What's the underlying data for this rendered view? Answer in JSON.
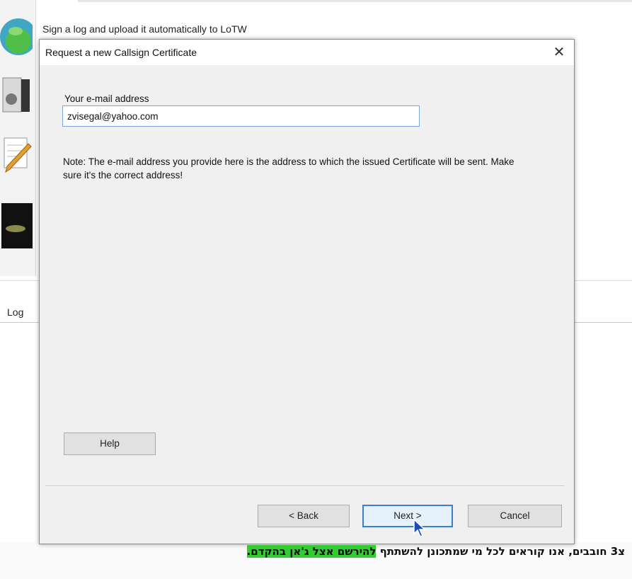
{
  "background_app": {
    "caption": "Sign a log and upload it automatically to LoTW",
    "log_label": "Log"
  },
  "dialog": {
    "title": "Request a new Callsign Certificate",
    "close_symbol": "✕",
    "email_label": "Your e-mail address",
    "email_value": "zvisegal@yahoo.com",
    "note": "Note: The e-mail address you provide here is the address to which the issued Certificate will be sent. Make sure it's the correct address!",
    "buttons": {
      "help": "Help",
      "back": "< Back",
      "next": "Next >",
      "cancel": "Cancel"
    }
  },
  "subtitle": {
    "plain": "צ3 חובבים, אנו קוראים לכל מי שמתכונן להשתתף ",
    "highlighted": "להירשם אצל ג'אן בהקדם."
  },
  "icons": [
    "globe-icon",
    "document-icon",
    "edit-pencil-icon",
    "dark-logo-icon",
    "mouse-cursor-icon"
  ],
  "colors": {
    "dialog_bg": "#f0f0f0",
    "focus_border": "#3c7fd1",
    "subtitle_highlight": "#33cc33"
  }
}
